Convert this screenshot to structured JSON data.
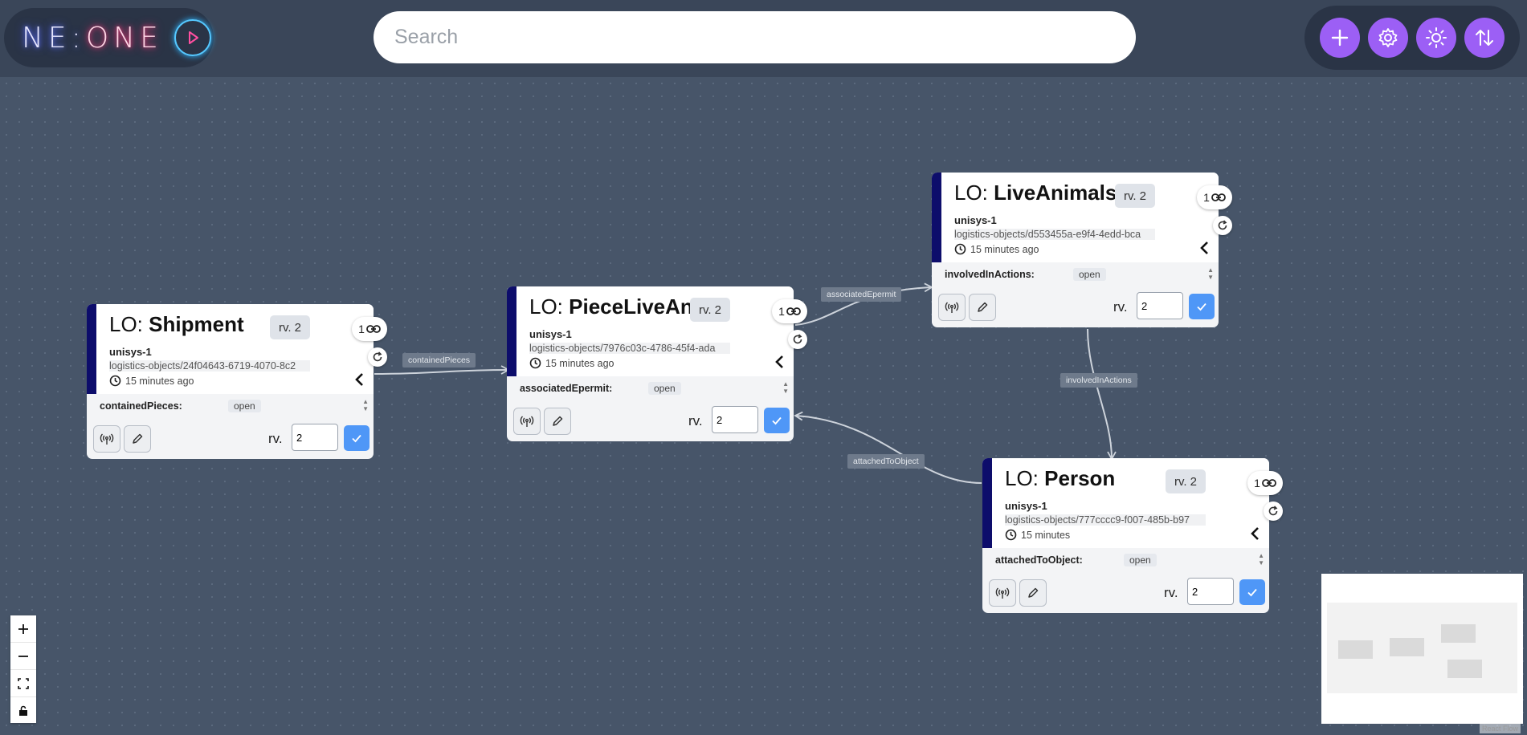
{
  "header": {
    "logo_text_left": "NE",
    "logo_sep": ":",
    "logo_text_right": "ONE",
    "search_placeholder": "Search",
    "toolbar": {
      "add": "plus-icon",
      "settings": "gear-icon",
      "theme": "sun-icon",
      "sort": "swap-vertical-icon"
    }
  },
  "nodes": [
    {
      "prefix": "LO:",
      "name": "Shipment",
      "revision": "rv. 2",
      "links": "1",
      "owner": "unisys-1",
      "object_id": "logistics-objects/24f04643-6719-4070-8c2",
      "time": "15 minutes ago",
      "property": "containedPieces:",
      "property_tag": "open",
      "rv_label": "rv.",
      "rv_value": "2"
    },
    {
      "prefix": "LO:",
      "name": "PieceLiveAnim",
      "revision": "rv. 2",
      "links": "1",
      "owner": "unisys-1",
      "object_id": "logistics-objects/7976c03c-4786-45f4-ada",
      "time": "15 minutes ago",
      "property": "associatedEpermit:",
      "property_tag": "open",
      "rv_label": "rv.",
      "rv_value": "2"
    },
    {
      "prefix": "LO:",
      "name": "LiveAnimalsEp",
      "revision": "rv. 2",
      "links": "1",
      "owner": "unisys-1",
      "object_id": "logistics-objects/d553455a-e9f4-4edd-bca",
      "time": "15 minutes ago",
      "property": "involvedInActions:",
      "property_tag": "open",
      "rv_label": "rv.",
      "rv_value": "2"
    },
    {
      "prefix": "LO:",
      "name": "Person",
      "revision": "rv. 2",
      "links": "1",
      "owner": "unisys-1",
      "object_id": "logistics-objects/777cccc9-f007-485b-b97",
      "time": "15 minutes",
      "property": "attachedToObject:",
      "property_tag": "open",
      "rv_label": "rv.",
      "rv_value": "2"
    }
  ],
  "edges": [
    {
      "label": "containedPieces"
    },
    {
      "label": "associatedEpermit"
    },
    {
      "label": "involvedInActions"
    },
    {
      "label": "attachedToObject"
    }
  ],
  "controls": {
    "zoom_in": "plus-icon",
    "zoom_out": "minus-icon",
    "fit_view": "fit-view-icon",
    "lock": "lock-icon"
  },
  "attribution": "React Flow"
}
